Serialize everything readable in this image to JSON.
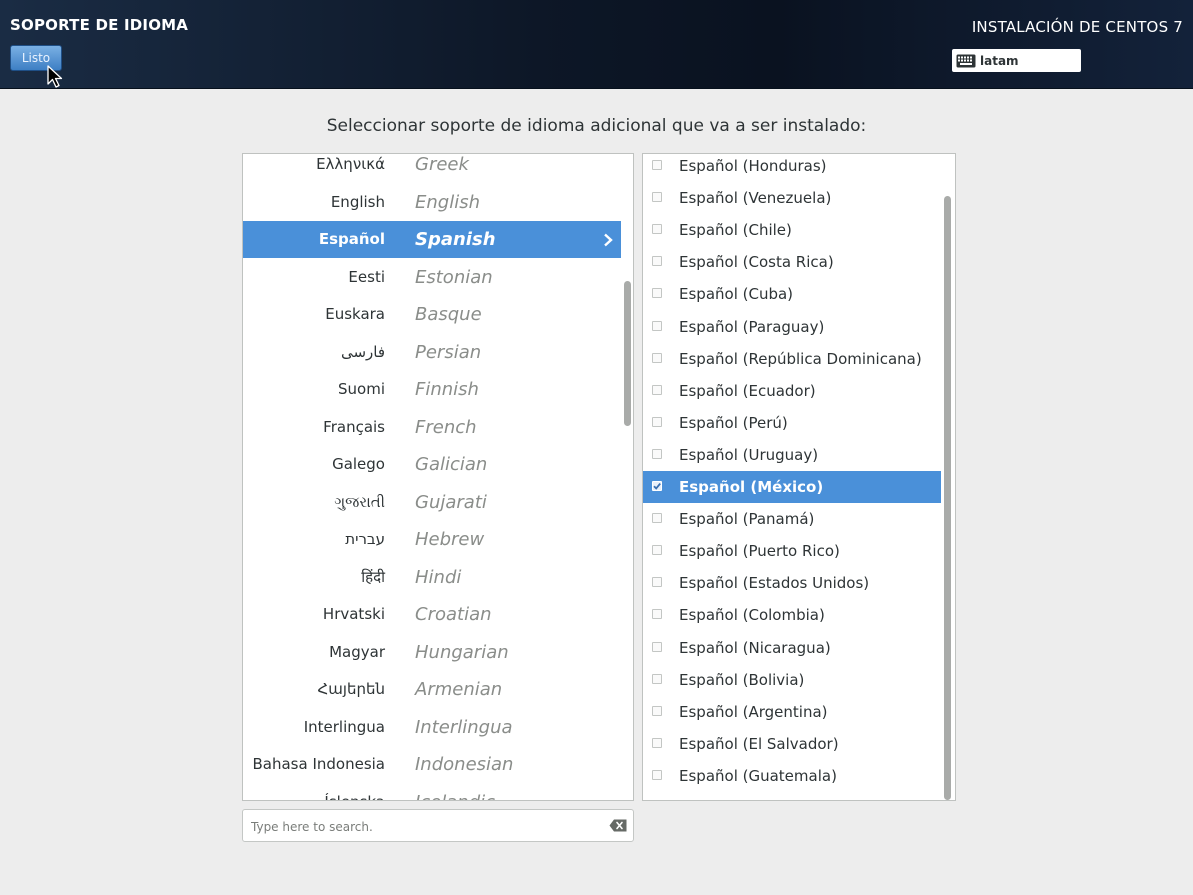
{
  "header": {
    "spoke_title": "SOPORTE DE IDIOMA",
    "done_label": "Listo",
    "product_title": "INSTALACIÓN DE CENTOS 7",
    "keyboard_layout": "latam"
  },
  "instruction": "Seleccionar soporte de idioma adicional que va a ser instalado:",
  "languages": [
    {
      "native": "Ελληνικά",
      "english": "Greek"
    },
    {
      "native": "English",
      "english": "English"
    },
    {
      "native": "Español",
      "english": "Spanish",
      "selected": true
    },
    {
      "native": "Eesti",
      "english": "Estonian"
    },
    {
      "native": "Euskara",
      "english": "Basque"
    },
    {
      "native": "فارسی",
      "english": "Persian"
    },
    {
      "native": "Suomi",
      "english": "Finnish"
    },
    {
      "native": "Français",
      "english": "French"
    },
    {
      "native": "Galego",
      "english": "Galician"
    },
    {
      "native": "ગુજરાતી",
      "english": "Gujarati"
    },
    {
      "native": "עברית",
      "english": "Hebrew"
    },
    {
      "native": "हिंदी",
      "english": "Hindi"
    },
    {
      "native": "Hrvatski",
      "english": "Croatian"
    },
    {
      "native": "Magyar",
      "english": "Hungarian"
    },
    {
      "native": "Հայերեն",
      "english": "Armenian"
    },
    {
      "native": "Interlingua",
      "english": "Interlingua"
    },
    {
      "native": "Bahasa Indonesia",
      "english": "Indonesian"
    },
    {
      "native": "Íslenska",
      "english": "Icelandic"
    }
  ],
  "search": {
    "placeholder": "Type here to search.",
    "value": ""
  },
  "locales": [
    {
      "label": "Español (Honduras)",
      "checked": false
    },
    {
      "label": "Español (Venezuela)",
      "checked": false
    },
    {
      "label": "Español (Chile)",
      "checked": false
    },
    {
      "label": "Español (Costa Rica)",
      "checked": false
    },
    {
      "label": "Español (Cuba)",
      "checked": false
    },
    {
      "label": "Español (Paraguay)",
      "checked": false
    },
    {
      "label": "Español (República Dominicana)",
      "checked": false
    },
    {
      "label": "Español (Ecuador)",
      "checked": false
    },
    {
      "label": "Español (Perú)",
      "checked": false
    },
    {
      "label": "Español (Uruguay)",
      "checked": false
    },
    {
      "label": "Español (México)",
      "checked": true,
      "selected": true
    },
    {
      "label": "Español (Panamá)",
      "checked": false
    },
    {
      "label": "Español (Puerto Rico)",
      "checked": false
    },
    {
      "label": "Español (Estados Unidos)",
      "checked": false
    },
    {
      "label": "Español (Colombia)",
      "checked": false
    },
    {
      "label": "Español (Nicaragua)",
      "checked": false
    },
    {
      "label": "Español (Bolivia)",
      "checked": false
    },
    {
      "label": "Español (Argentina)",
      "checked": false
    },
    {
      "label": "Español (El Salvador)",
      "checked": false
    },
    {
      "label": "Español (Guatemala)",
      "checked": false
    }
  ],
  "colors": {
    "header_bg": "#0d1727",
    "selection": "#4a90d9",
    "button": "#5a96d4",
    "page_bg": "#ededed"
  },
  "icons": {
    "cursor": "pointer-cursor-icon",
    "keyboard": "keyboard-icon",
    "row_arrow": "chevron-right-icon",
    "clear_search": "backspace-clear-icon",
    "checkbox": "checkbox-icon"
  }
}
